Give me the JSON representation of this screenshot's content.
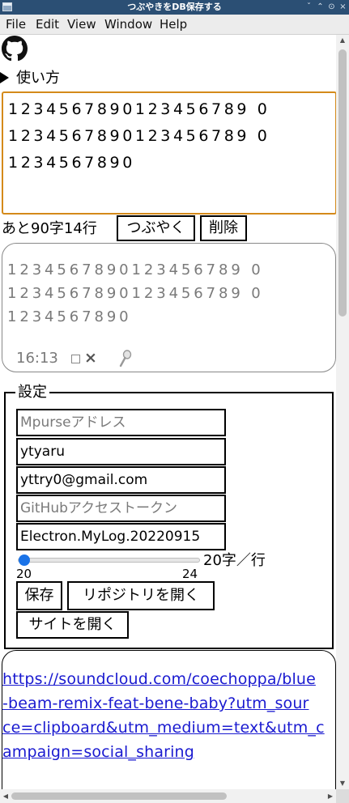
{
  "window": {
    "title": "つぶやきをDB保存する",
    "controls": [
      "ˇ",
      "⌃",
      "⊙",
      "×"
    ]
  },
  "menu": [
    "File",
    "Edit",
    "View",
    "Window",
    "Help"
  ],
  "github_icon": "github-icon",
  "usage": {
    "label": "使い方"
  },
  "editor": {
    "lines": [
      "1234567890123456789 0",
      "1234567890123456789 0",
      "1234567890"
    ]
  },
  "counter": {
    "text": "あと90字14行"
  },
  "actions": {
    "post": "つぶやく",
    "delete": "削除"
  },
  "preview": {
    "lines": [
      "1234567890123456789 0",
      "1234567890123456789 0",
      "1234567890"
    ],
    "time": "16:13",
    "delete_mark": "×"
  },
  "settings": {
    "legend": "設定",
    "mpurse": {
      "placeholder": "Mpurseアドレス",
      "value": ""
    },
    "username": {
      "value": "ytyaru"
    },
    "email": {
      "value": "yttry0@gmail.com"
    },
    "token": {
      "placeholder": "GitHubアクセストークン",
      "value": ""
    },
    "repo": {
      "value": "Electron.MyLog.20220915"
    },
    "chars_per_line": {
      "value": 20,
      "min": 20,
      "max": 24,
      "label": "20字／行",
      "min_label": "20",
      "max_label": "24"
    },
    "save": "保存",
    "open_repo": "リポジトリを開く",
    "open_site": "サイトを開く"
  },
  "card": {
    "url_lines": [
      "https://soundcloud.com/coechoppa/blue",
      "-beam-remix-feat-bene-baby?utm_sour",
      "ce=clipboard&utm_medium=text&utm_c",
      "ampaign=social_sharing"
    ]
  },
  "colors": {
    "titlebar": "#2b4f74",
    "focus": "#d48a1a",
    "link": "#1a1ad0",
    "slider": "#1a73e8"
  }
}
